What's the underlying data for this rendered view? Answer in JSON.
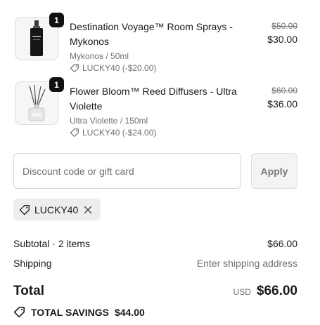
{
  "line_items": [
    {
      "quantity": "1",
      "title": "Destination Voyage™ Room Sprays - Mykonos",
      "variant": "Mykonos / 50ml",
      "discount": "LUCKY40 (-$20.00)",
      "original_price": "$50.00",
      "price": "$30.00",
      "image_icon": "room-spray-bottle"
    },
    {
      "quantity": "1",
      "title": "Flower Bloom™ Reed Diffusers - Ultra Violette",
      "variant": "Ultra Violette / 150ml",
      "discount": "LUCKY40 (-$24.00)",
      "original_price": "$60.00",
      "price": "$36.00",
      "image_icon": "reed-diffuser"
    }
  ],
  "discount": {
    "placeholder": "Discount code or gift card",
    "value": "",
    "apply_label": "Apply",
    "applied_code": "LUCKY40"
  },
  "summary": {
    "subtotal_label": "Subtotal · 2 items",
    "subtotal_value": "$66.00",
    "shipping_label": "Shipping",
    "shipping_value": "Enter shipping address",
    "total_label": "Total",
    "currency": "USD",
    "total_value": "$66.00",
    "savings_label": "TOTAL SAVINGS",
    "savings_value": "$44.00"
  },
  "colors": {
    "text": "#1a1a1a",
    "muted": "#707070",
    "badge": "#111111",
    "chip_bg": "#ededed"
  }
}
